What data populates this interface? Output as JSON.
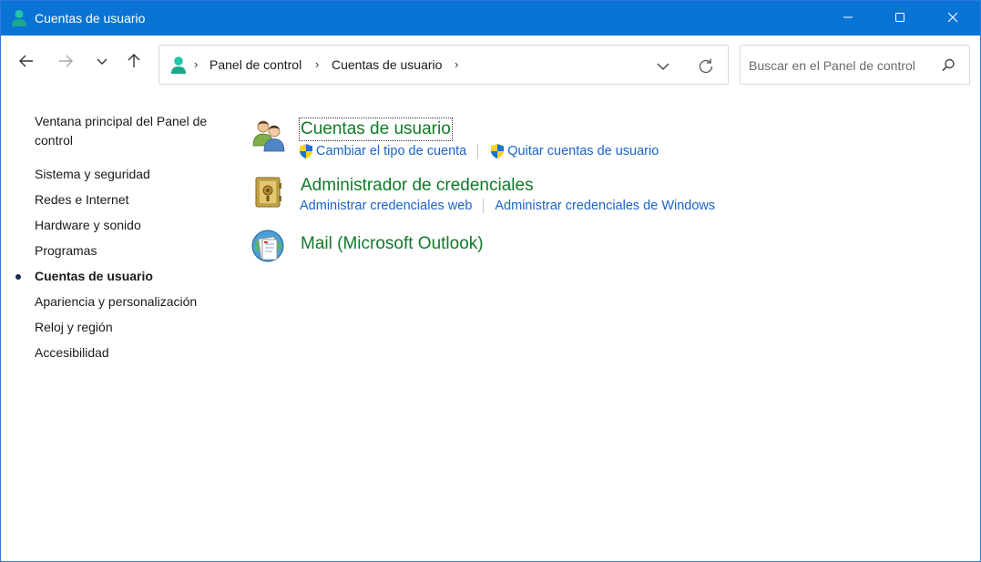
{
  "window": {
    "title": "Cuentas de usuario",
    "accent": "#0a74d4"
  },
  "titlebar": {
    "icon": "user-accounts-icon",
    "minimize_icon": "minimize-icon",
    "maximize_icon": "maximize-icon",
    "close_icon": "close-icon"
  },
  "nav": {
    "back_icon": "arrow-left-icon",
    "forward_icon": "arrow-right-icon",
    "recent_icon": "chevron-down-icon",
    "up_icon": "arrow-up-icon"
  },
  "address": {
    "breadcrumbs": [
      "Panel de control",
      "Cuentas de usuario"
    ],
    "separator": "›"
  },
  "search": {
    "placeholder": "Buscar en el Panel de control",
    "value": ""
  },
  "sidebar": {
    "home_label": "Ventana principal del Panel de control",
    "items": [
      {
        "label": "Sistema y seguridad",
        "active": false
      },
      {
        "label": "Redes e Internet",
        "active": false
      },
      {
        "label": "Hardware y sonido",
        "active": false
      },
      {
        "label": "Programas",
        "active": false
      },
      {
        "label": "Cuentas de usuario",
        "active": true
      },
      {
        "label": "Apariencia y personalización",
        "active": false
      },
      {
        "label": "Reloj y región",
        "active": false
      },
      {
        "label": "Accesibilidad",
        "active": false
      }
    ]
  },
  "categories": [
    {
      "title": "Cuentas de usuario",
      "icon": "users-icon",
      "links": [
        {
          "label": "Cambiar el tipo de cuenta",
          "shield": true
        },
        {
          "label": "Quitar cuentas de usuario",
          "shield": true
        }
      ]
    },
    {
      "title": "Administrador de credenciales",
      "icon": "vault-icon",
      "links": [
        {
          "label": "Administrar credenciales web",
          "shield": false
        },
        {
          "label": "Administrar credenciales de Windows",
          "shield": false
        }
      ]
    },
    {
      "title": "Mail (Microsoft Outlook)",
      "icon": "mail-globe-icon",
      "links": []
    }
  ],
  "colors": {
    "category_title": "#117a28",
    "link": "#1a64c6"
  }
}
